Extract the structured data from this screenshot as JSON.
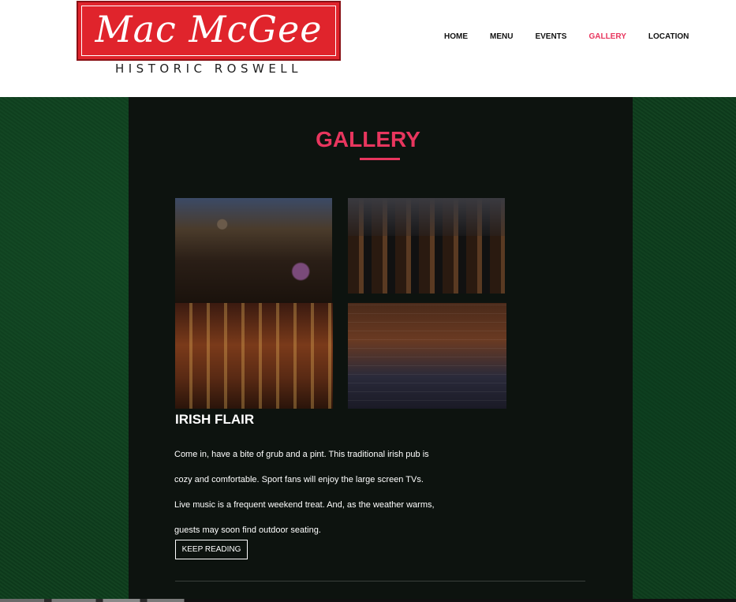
{
  "logo": {
    "title": "Mac McGee",
    "subtitle": "HISTORIC ROSWELL"
  },
  "nav": {
    "items": [
      "HOME",
      "MENU",
      "EVENTS",
      "GALLERY",
      "LOCATION"
    ],
    "active": "GALLERY"
  },
  "page": {
    "title": "GALLERY"
  },
  "gallery": {
    "photos": [
      "pub-interior-photo",
      "whiskey-bottles-photo",
      "bar-counter-photo",
      "dining-hall-photo"
    ]
  },
  "article": {
    "heading": "IRISH FLAIR",
    "lines": [
      "Come in, have a bite of grub and a pint. This traditional irish pub is",
      "cozy and comfortable. Sport fans will enjoy the large screen TVs.",
      "Live music is a frequent weekend treat. And, as the weather warms,",
      "guests may soon find outdoor seating."
    ],
    "button_label": "KEEP READING"
  },
  "colors": {
    "accent": "#e8365e",
    "logo_red": "#e0242c",
    "felt_green": "#0e3e1d",
    "panel": "#0d130f"
  }
}
